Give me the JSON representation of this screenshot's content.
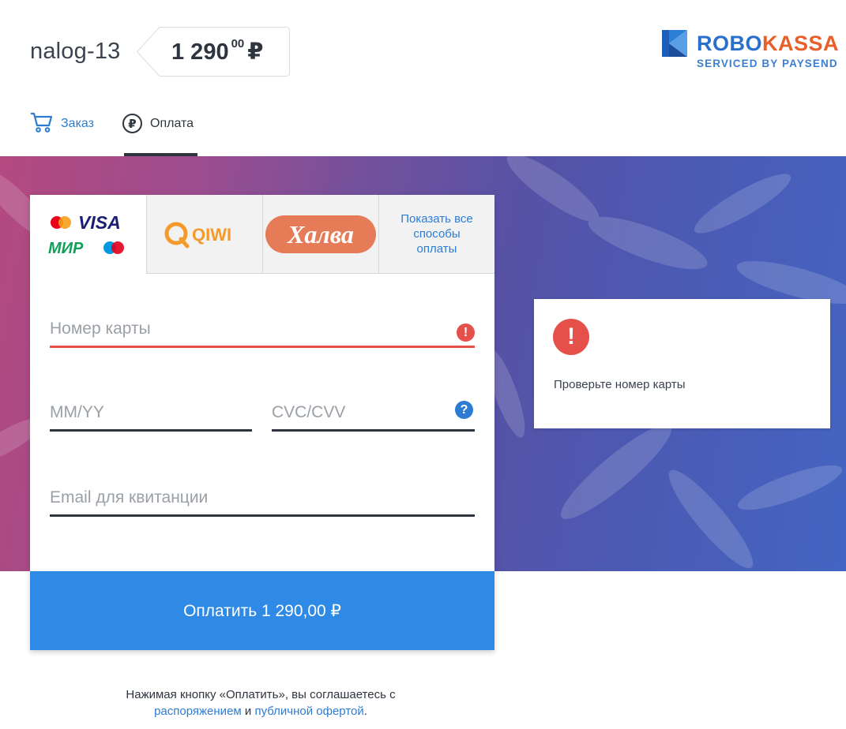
{
  "header": {
    "order_name": "nalog-13",
    "price_main": "1 290",
    "price_cents": "00",
    "currency": "₽",
    "logo_robo": "ROBO",
    "logo_kassa": "KASSA",
    "logo_sub": "SERVICED BY PAYSEND"
  },
  "nav": {
    "order_label": "Заказ",
    "pay_label": "Оплата",
    "pay_icon_glyph": "₽"
  },
  "methods": {
    "visa": "VISA",
    "mir": "МИР",
    "qiwi": "QIWI",
    "halva": "Халва",
    "more": "Показать все способы оплаты"
  },
  "form": {
    "card_number_placeholder": "Номер карты",
    "expiry_placeholder": "MM/YY",
    "cvc_placeholder": "CVC/CVV",
    "email_placeholder": "Email для квитанции",
    "pay_button": "Оплатить 1 290,00 ₽"
  },
  "error": {
    "message": "Проверьте номер карты"
  },
  "agreement": {
    "text_before": "Нажимая кнопку «Оплатить», вы соглашаетесь с",
    "link_order": "распоряжением",
    "conj": "и",
    "link_offer": "публичной офертой",
    "end": "."
  },
  "colors": {
    "accent": "#2f8ae5",
    "link": "#2d7cd3",
    "error": "#e6504a",
    "qiwi": "#f39a2b",
    "halva": "#e57b57"
  }
}
